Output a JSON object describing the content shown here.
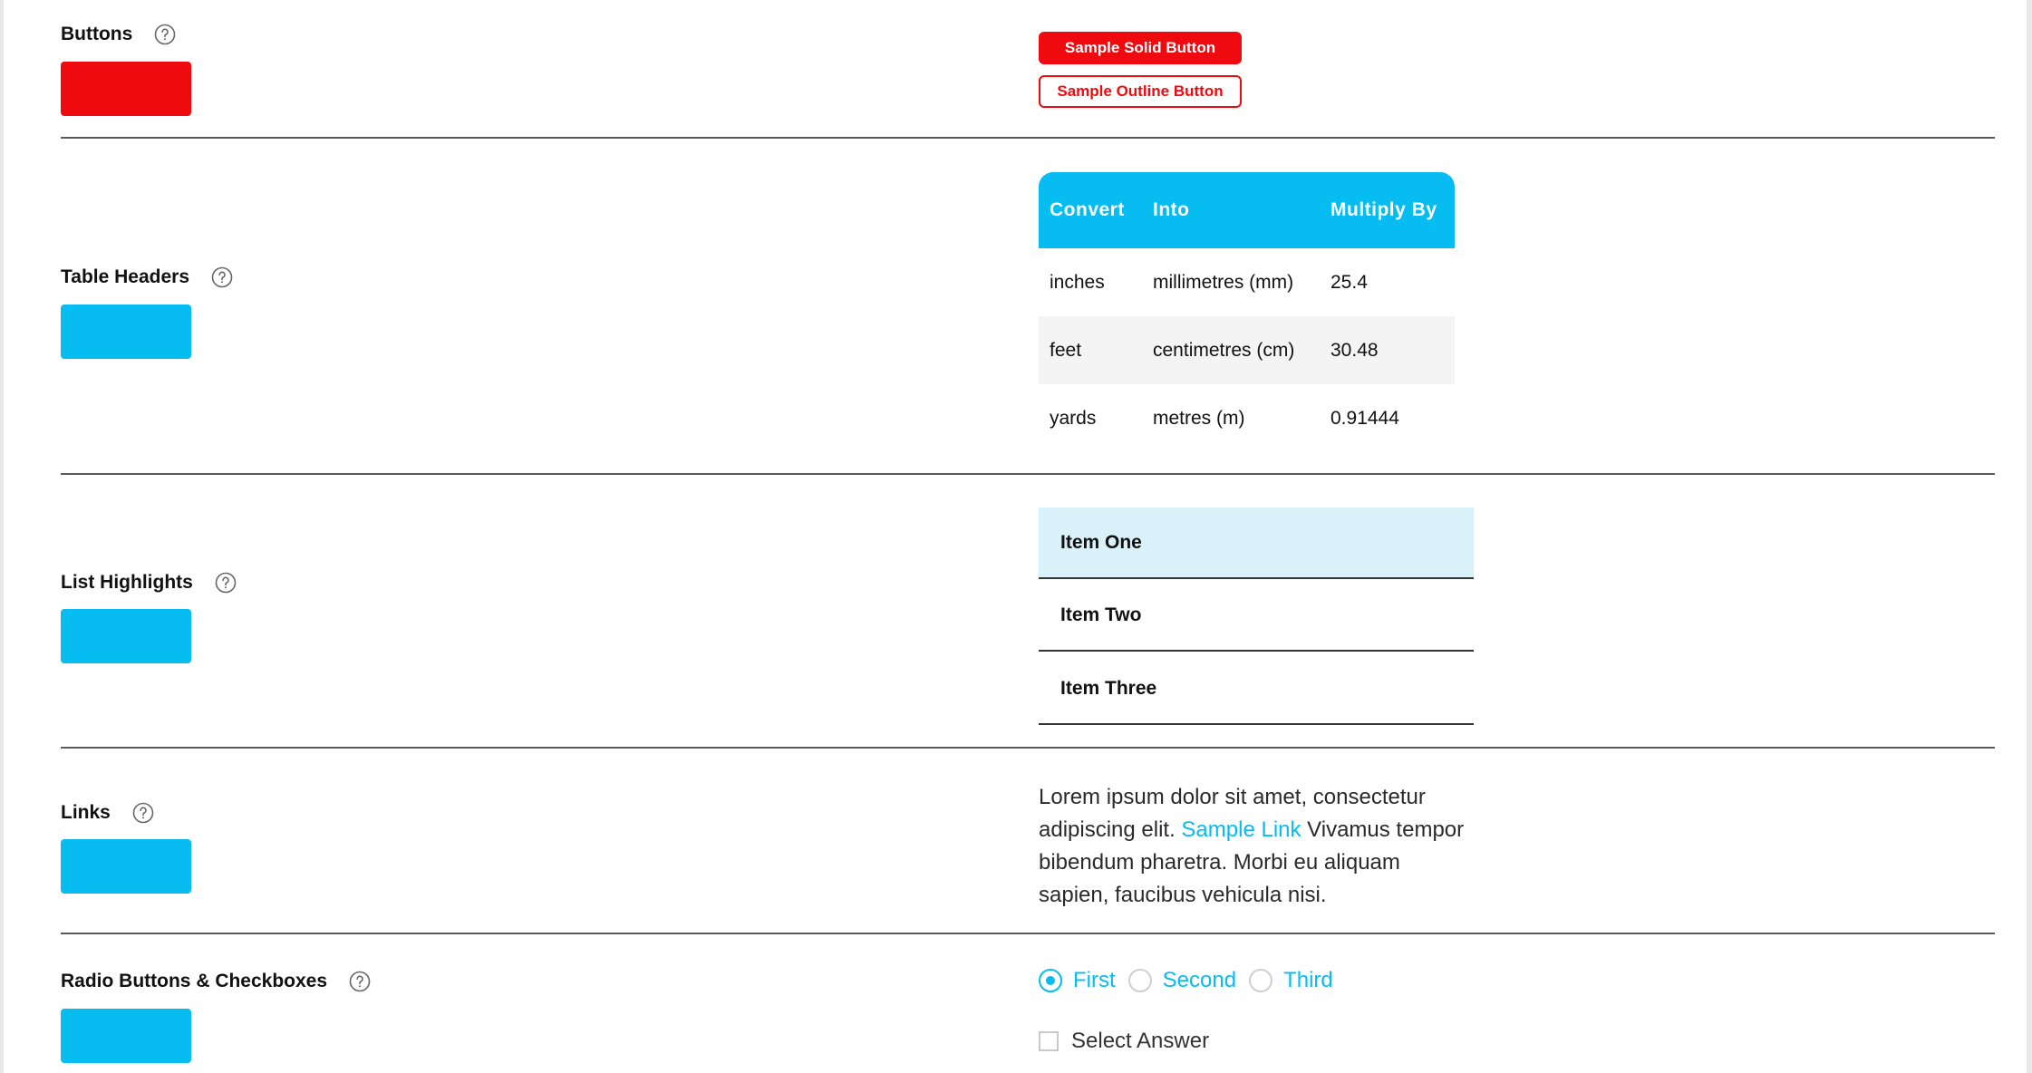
{
  "colors": {
    "primary_red": "#ee0a0e",
    "primary_blue": "#06bcf1",
    "list_highlight": "#d9f1f9"
  },
  "sections": {
    "buttons": {
      "label": "Buttons",
      "help_icon": "question-circle-icon"
    },
    "table_headers": {
      "label": "Table Headers",
      "help_icon": "question-circle-icon"
    },
    "list_highlights": {
      "label": "List Highlights",
      "help_icon": "question-circle-icon"
    },
    "links": {
      "label": "Links",
      "help_icon": "question-circle-icon"
    },
    "radios": {
      "label": "Radio Buttons & Checkboxes",
      "help_icon": "question-circle-icon"
    }
  },
  "buttons_demo": {
    "solid_label": "Sample Solid Button",
    "outline_label": "Sample Outline Button"
  },
  "table": {
    "headers": [
      "Convert",
      "Into",
      "Multiply By"
    ],
    "rows": [
      [
        "inches",
        "millimetres (mm)",
        "25.4"
      ],
      [
        "feet",
        "centimetres (cm)",
        "30.48"
      ],
      [
        "yards",
        "metres (m)",
        "0.91444"
      ]
    ]
  },
  "list": {
    "items": [
      "Item One",
      "Item Two",
      "Item Three"
    ],
    "highlighted_index": 0
  },
  "links_demo": {
    "text_before": "Lorem ipsum dolor sit amet, consectetur adipiscing elit. ",
    "link_text": "Sample Link",
    "text_after": " Vivamus tempor bibendum pharetra. Morbi eu aliquam sapien, faucibus vehicula nisi."
  },
  "radios_demo": {
    "options": [
      "First",
      "Second",
      "Third"
    ],
    "selected": "First",
    "checkbox_label": "Select Answer",
    "checkbox_checked": false
  }
}
